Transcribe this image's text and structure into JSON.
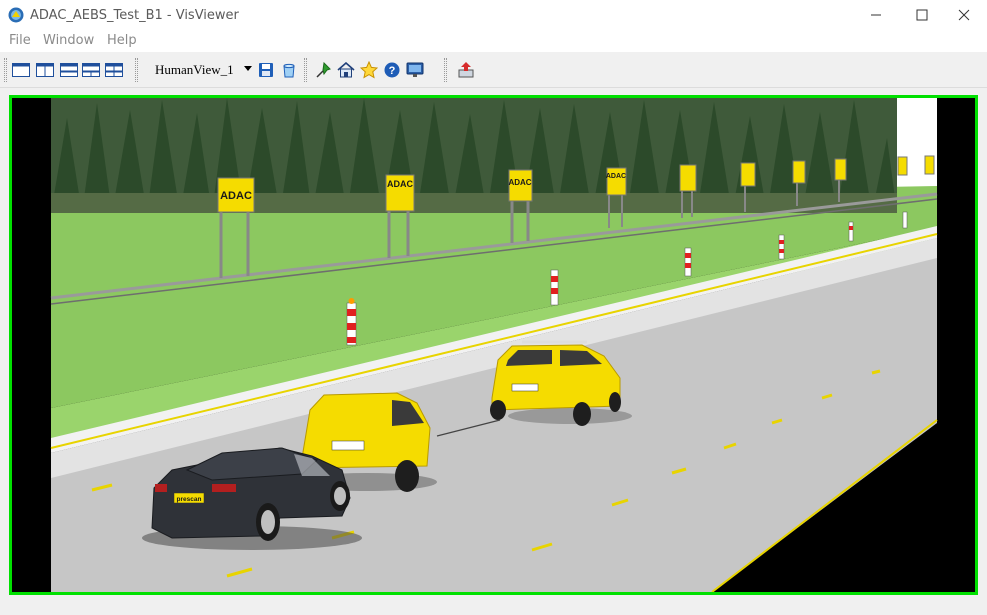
{
  "window": {
    "title": "ADAC_AEBS_Test_B1 - VisViewer",
    "minimize_icon": "minimize-icon",
    "maximize_icon": "maximize-icon",
    "close_icon": "close-icon"
  },
  "menu": {
    "items": [
      "File",
      "Window",
      "Help"
    ]
  },
  "toolbar": {
    "layout_buttons": [
      "layout-single-icon",
      "layout-split-vertical-icon",
      "layout-split-horizontal-icon",
      "layout-three-pane-icon",
      "layout-quad-icon"
    ],
    "view_select": {
      "value": "HumanView_1"
    },
    "actions": [
      "save-icon",
      "clear-icon",
      "pin-icon",
      "home-view-icon",
      "favorite-star-icon",
      "help-icon",
      "display-icon",
      "export-icon"
    ]
  },
  "scene": {
    "billboard_text": "ADAC",
    "plate_front_car": "prescan",
    "colors": {
      "viewport_border": "#00e000",
      "grass": "#8cc860",
      "road": "#c8c8c8",
      "adac_yellow": "#f5dc00",
      "sedan": "#2f3238"
    }
  }
}
